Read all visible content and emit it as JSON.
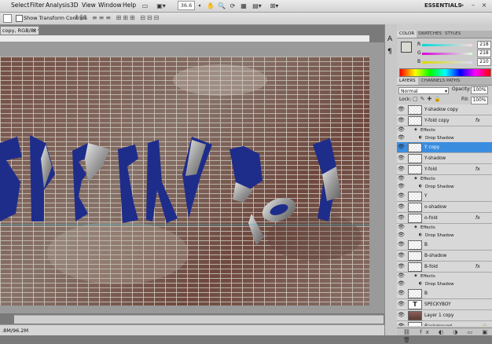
{
  "menubar": {
    "items": [
      "Select",
      "Filter",
      "Analysis",
      "3D",
      "View",
      "Window",
      "Help"
    ],
    "zoom_value": "36.6",
    "workspace": "ESSENTIALS"
  },
  "options_bar": {
    "show_transform_controls": "Show Transform Controls"
  },
  "document": {
    "tab_title": "copy, RGB/8) *",
    "status_text": ".8M/96.2M"
  },
  "color_panel": {
    "tabs": [
      "COLOR",
      "SWATCHES",
      "STYLES"
    ],
    "channels": [
      {
        "label": "R",
        "value": "218",
        "from": "#00dada",
        "to": "#ffdada"
      },
      {
        "label": "G",
        "value": "218",
        "from": "#da00da",
        "to": "#daffda"
      },
      {
        "label": "B",
        "value": "210",
        "from": "#dada00",
        "to": "#dadaff"
      }
    ]
  },
  "layers_panel": {
    "tabs": [
      "LAYERS",
      "CHANNELS",
      "PATHS"
    ],
    "blend_mode": "Normal",
    "opacity_label": "Opacity:",
    "opacity_value": "100%",
    "lock_label": "Lock:",
    "fill_label": "Fill:",
    "fill_value": "100%",
    "rows": [
      {
        "kind": "layer",
        "name": "Y-shadow copy",
        "thumb": "transparent",
        "fx": false,
        "selected": false
      },
      {
        "kind": "layer",
        "name": "Y-fold copy",
        "thumb": "transparent",
        "fx": true,
        "selected": false
      },
      {
        "kind": "effects",
        "name": "Effects"
      },
      {
        "kind": "effect",
        "name": "Drop Shadow"
      },
      {
        "kind": "layer",
        "name": "Y copy",
        "thumb": "transparent",
        "fx": false,
        "selected": true
      },
      {
        "kind": "layer",
        "name": "Y-shadow",
        "thumb": "transparent",
        "fx": false,
        "selected": false
      },
      {
        "kind": "layer",
        "name": "Y-fold",
        "thumb": "transparent",
        "fx": true,
        "selected": false
      },
      {
        "kind": "effects",
        "name": "Effects"
      },
      {
        "kind": "effect",
        "name": "Drop Shadow"
      },
      {
        "kind": "layer",
        "name": "Y",
        "thumb": "transparent",
        "fx": false,
        "selected": false
      },
      {
        "kind": "layer",
        "name": "o-shadow",
        "thumb": "transparent",
        "fx": false,
        "selected": false
      },
      {
        "kind": "layer",
        "name": "o-fold",
        "thumb": "transparent",
        "fx": true,
        "selected": false
      },
      {
        "kind": "effects",
        "name": "Effects"
      },
      {
        "kind": "effect",
        "name": "Drop Shadow"
      },
      {
        "kind": "layer",
        "name": "B",
        "thumb": "transparent",
        "fx": false,
        "selected": false
      },
      {
        "kind": "layer",
        "name": "B-shadow",
        "thumb": "transparent",
        "fx": false,
        "selected": false
      },
      {
        "kind": "layer",
        "name": "B-fold",
        "thumb": "transparent",
        "fx": true,
        "selected": false
      },
      {
        "kind": "effects",
        "name": "Effects"
      },
      {
        "kind": "effect",
        "name": "Drop Shadow"
      },
      {
        "kind": "layer",
        "name": "B",
        "thumb": "transparent",
        "fx": false,
        "selected": false
      },
      {
        "kind": "layer",
        "name": "SPECKYBOY",
        "thumb": "text",
        "fx": false,
        "selected": false
      },
      {
        "kind": "layer",
        "name": "Layer 1 copy",
        "thumb": "brick",
        "fx": false,
        "selected": false
      },
      {
        "kind": "layer",
        "name": "Background",
        "thumb": "white",
        "fx": false,
        "selected": false,
        "italic": true,
        "locked": true
      }
    ]
  },
  "artwork": {
    "letters": [
      "S",
      "P",
      "E",
      "C",
      "K",
      "Y",
      "B",
      "o",
      "Y"
    ],
    "letter_color": "#1f2d8a"
  }
}
